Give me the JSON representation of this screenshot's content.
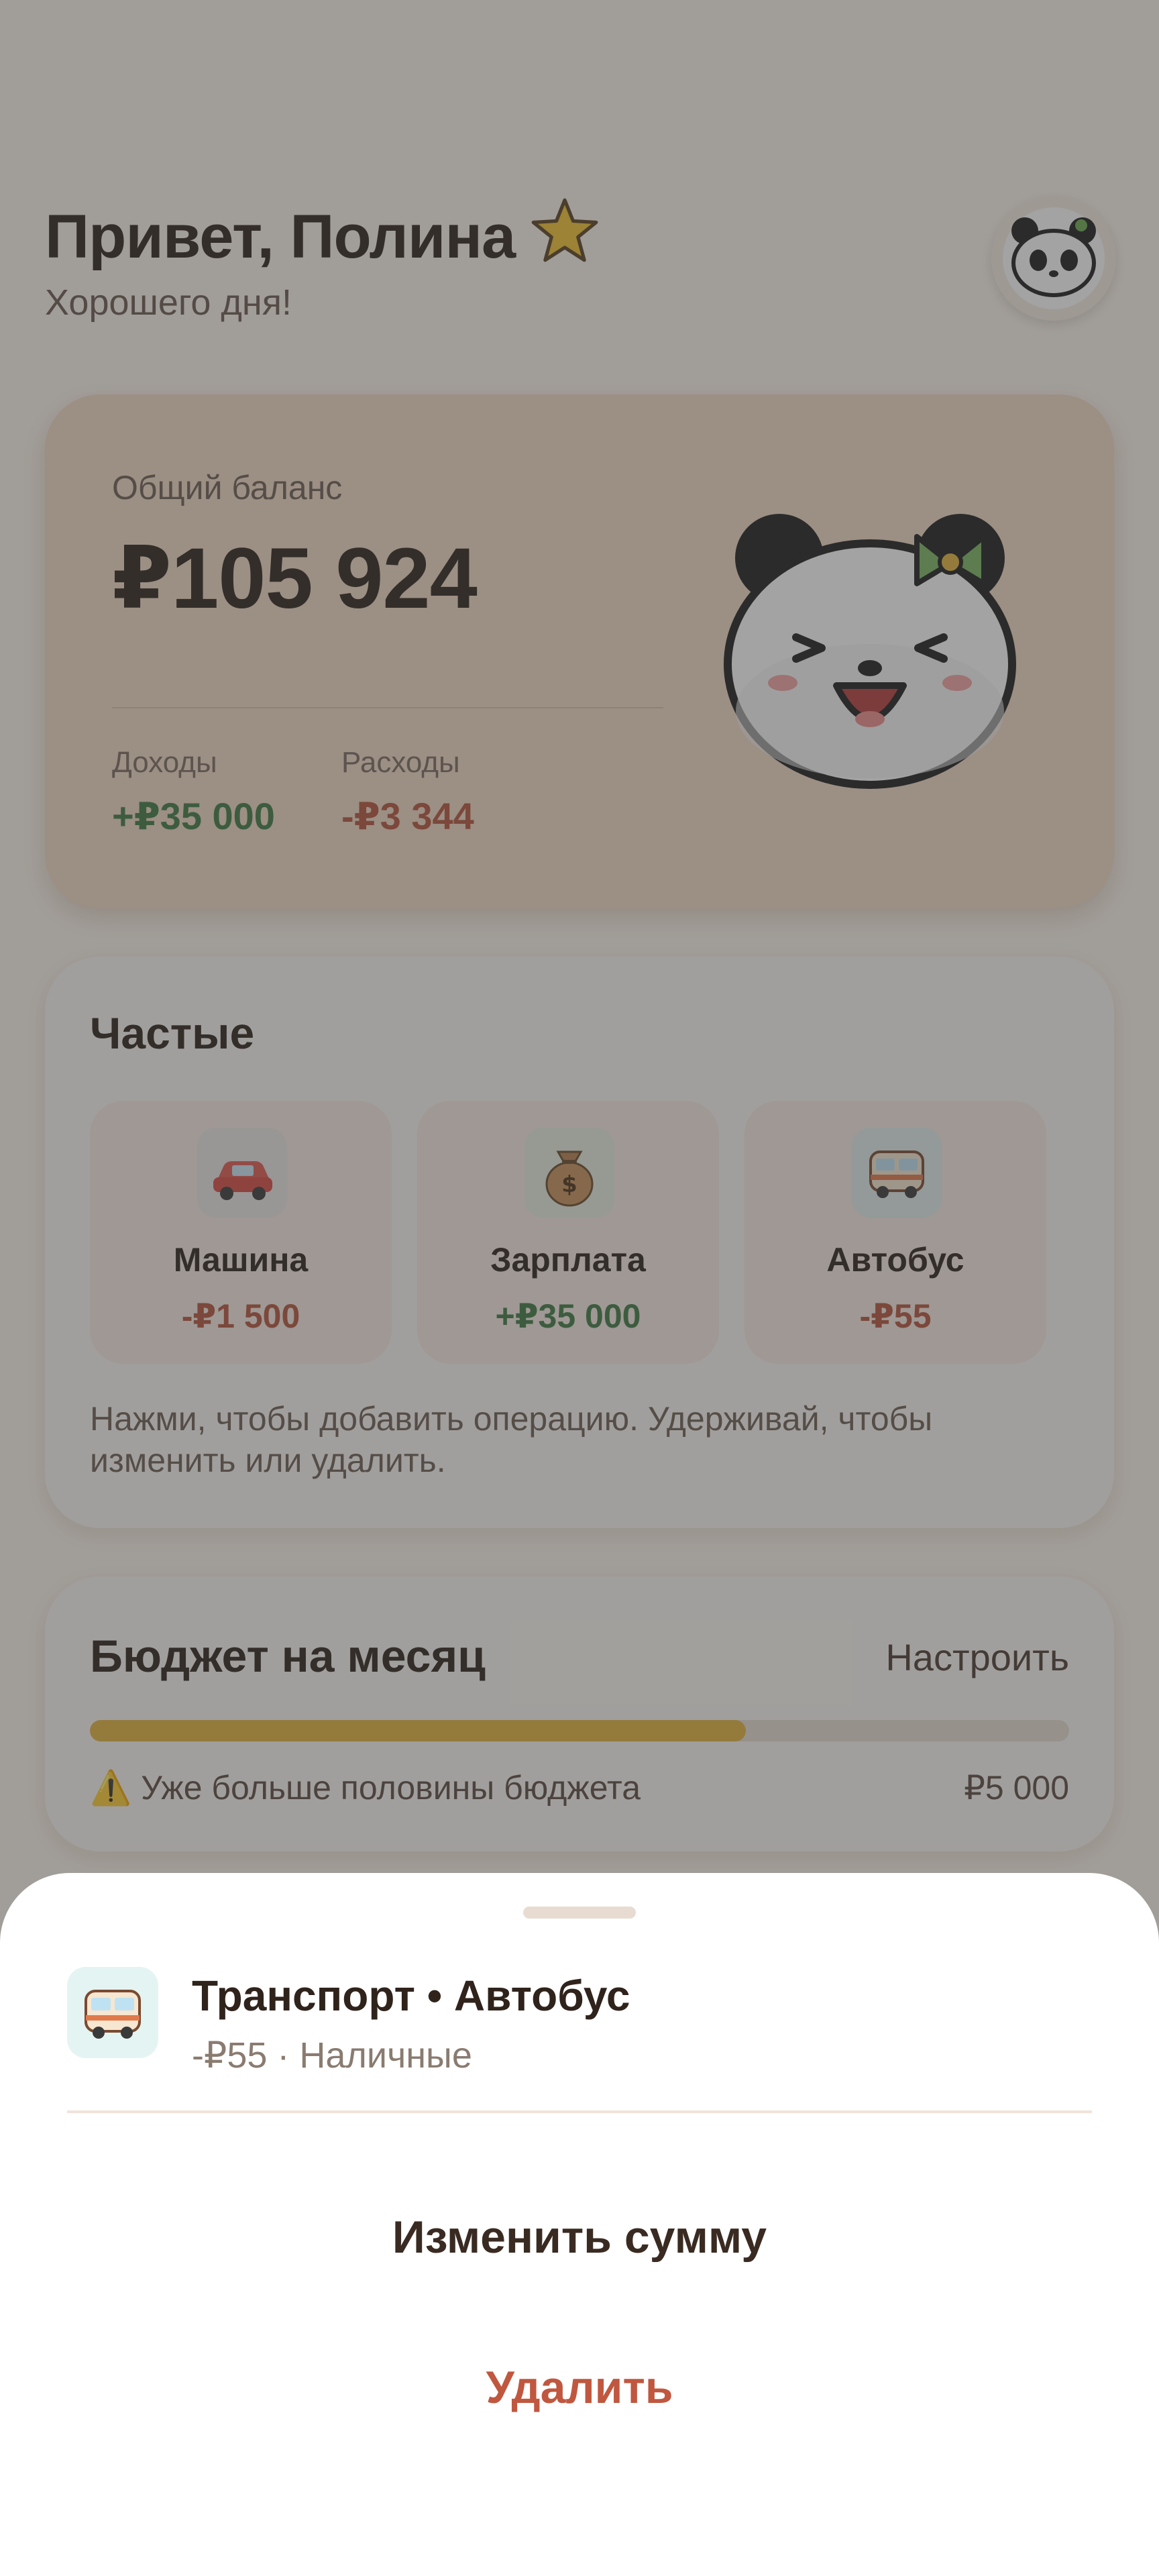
{
  "header": {
    "greeting": "Привет, Полина",
    "subtitle": "Хорошего дня!"
  },
  "balance": {
    "label": "Общий баланс",
    "value": "₽105 924",
    "income_label": "Доходы",
    "income_value": "+₽35 000",
    "expense_label": "Расходы",
    "expense_value": "-₽3 344"
  },
  "frequent": {
    "title": "Частые",
    "items": [
      {
        "name": "Машина",
        "amount": "-₽1 500",
        "icon": "car-icon"
      },
      {
        "name": "Зарплата",
        "amount": "+₽35 000",
        "icon": "money-bag-icon"
      },
      {
        "name": "Автобус",
        "amount": "-₽55",
        "icon": "bus-icon"
      }
    ],
    "hint": "Нажми, чтобы добавить операцию. Удерживай, чтобы изменить или удалить."
  },
  "budget": {
    "title": "Бюджет на месяц",
    "configure": "Настроить",
    "progress": 0.67,
    "warning_icon": "⚠️",
    "warning": "Уже больше половины бюджета",
    "total": "₽5 000"
  },
  "sheet": {
    "title": "Транспорт • Автобус",
    "subtitle": "-₽55 · Наличные",
    "edit_label": "Изменить сумму",
    "delete_label": "Удалить"
  },
  "colors": {
    "income": "#3f7a43",
    "expense": "#b4533b",
    "budget_fill": "#e3b33d",
    "balance_card": "#f1dac5"
  }
}
